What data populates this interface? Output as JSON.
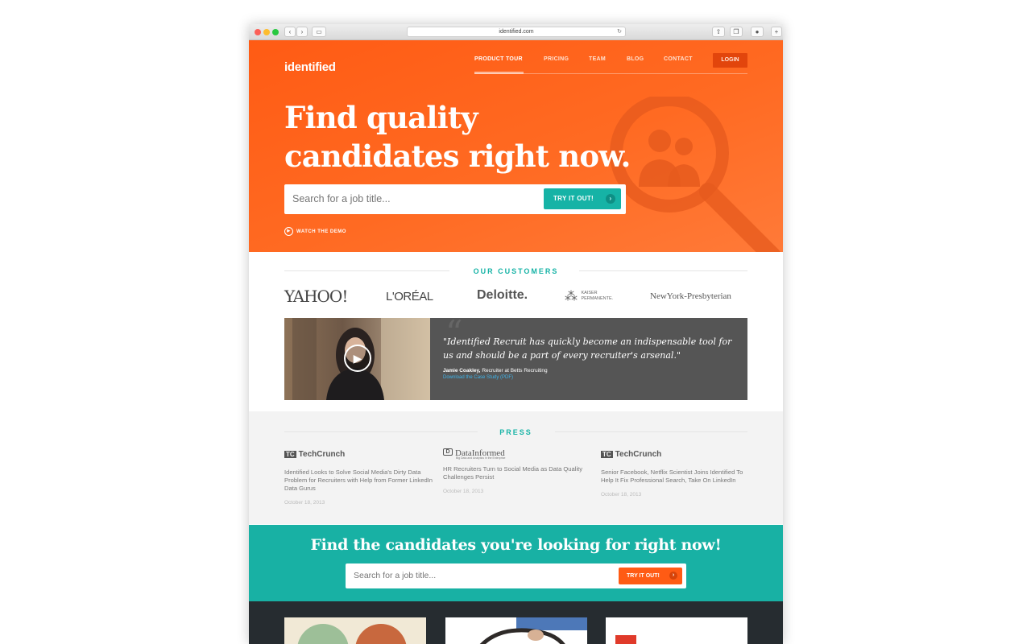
{
  "browser": {
    "url": "identified.com"
  },
  "header": {
    "logo": "identified",
    "nav": [
      {
        "label": "PRODUCT TOUR"
      },
      {
        "label": "PRICING"
      },
      {
        "label": "TEAM"
      },
      {
        "label": "BLOG"
      },
      {
        "label": "CONTACT"
      }
    ],
    "login": "LOGIN"
  },
  "hero": {
    "headline_line1": "Find quality",
    "headline_line2": "candidates right now.",
    "search_placeholder": "Search for a job title...",
    "cta": "TRY IT OUT!",
    "demo_link": "WATCH THE DEMO"
  },
  "customers": {
    "heading": "OUR CUSTOMERS",
    "logos": [
      "YAHOO!",
      "L'ORÉAL",
      "Deloitte.",
      "KAISER PERMANENTE.",
      "NewYork-Presbyterian"
    ]
  },
  "testimonial": {
    "quote": "\"Identified Recruit has quickly become an indispensable tool for us and should be a part of every recruiter's arsenal.\"",
    "author": "Jamie Coakley,",
    "author_role": "Recruiter at Betts Recruiting",
    "link": "Download the Case Study (PDF)"
  },
  "press": {
    "heading": "PRESS",
    "items": [
      {
        "source": "TechCrunch",
        "title": "Identified Looks to Solve Social Media's Dirty Data Problem for Recruiters with Help from Former LinkedIn Data Gurus",
        "date": "October 18, 2013"
      },
      {
        "source": "DataInformed",
        "tagline": "Big Data and Analytics in the Enterprise",
        "title": "HR Recruiters Turn to Social Media as Data Quality Challenges Persist",
        "date": "October 18, 2013"
      },
      {
        "source": "TechCrunch",
        "title": "Senior Facebook, Netflix Scientist Joins Identified To Help It Fix Professional Search, Take On LinkedIn",
        "date": "October 18, 2013"
      }
    ]
  },
  "cta_band": {
    "headline": "Find the candidates you're looking for right now!",
    "search_placeholder": "Search for a job title...",
    "cta": "TRY IT OUT!"
  },
  "colors": {
    "brand_orange": "#ff5b14",
    "teal": "#18b1a4",
    "dark": "#262c30"
  }
}
